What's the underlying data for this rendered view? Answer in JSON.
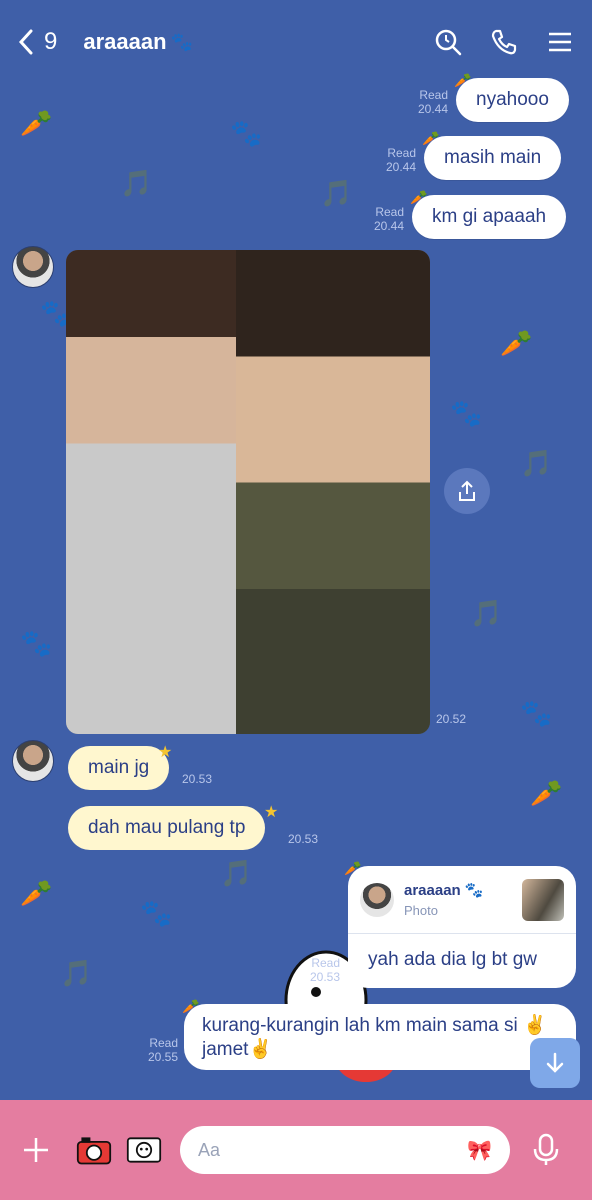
{
  "header": {
    "back_count": "9",
    "title": "araaaan",
    "title_emoji": "🐾"
  },
  "messages": {
    "out1": {
      "text": "nyahooo",
      "read": "Read",
      "time": "20.44"
    },
    "out2": {
      "text": "masih main",
      "read": "Read",
      "time": "20.44"
    },
    "out3": {
      "text": "km gi apaaah",
      "read": "Read",
      "time": "20.44"
    },
    "photo_time": "20.52",
    "in1": {
      "text": "main jg",
      "time": "20.53"
    },
    "in2": {
      "text": "dah mau pulang tp",
      "time": "20.53"
    },
    "reply": {
      "name": "araaaan",
      "name_emoji": "🐾",
      "type": "Photo",
      "text": "yah ada dia lg bt gw",
      "read": "Read",
      "time": "20.53"
    },
    "out4": {
      "text": "kurang-kurangin lah km main sama si ✌️ jamet✌️",
      "read": "Read",
      "time": "20.55"
    }
  },
  "composer": {
    "placeholder": "Aa"
  },
  "colors": {
    "background": "#3f5fa8",
    "bottom_bar": "#e47da0",
    "incoming_bubble": "#fff7cf",
    "outgoing_bubble": "#ffffff"
  }
}
